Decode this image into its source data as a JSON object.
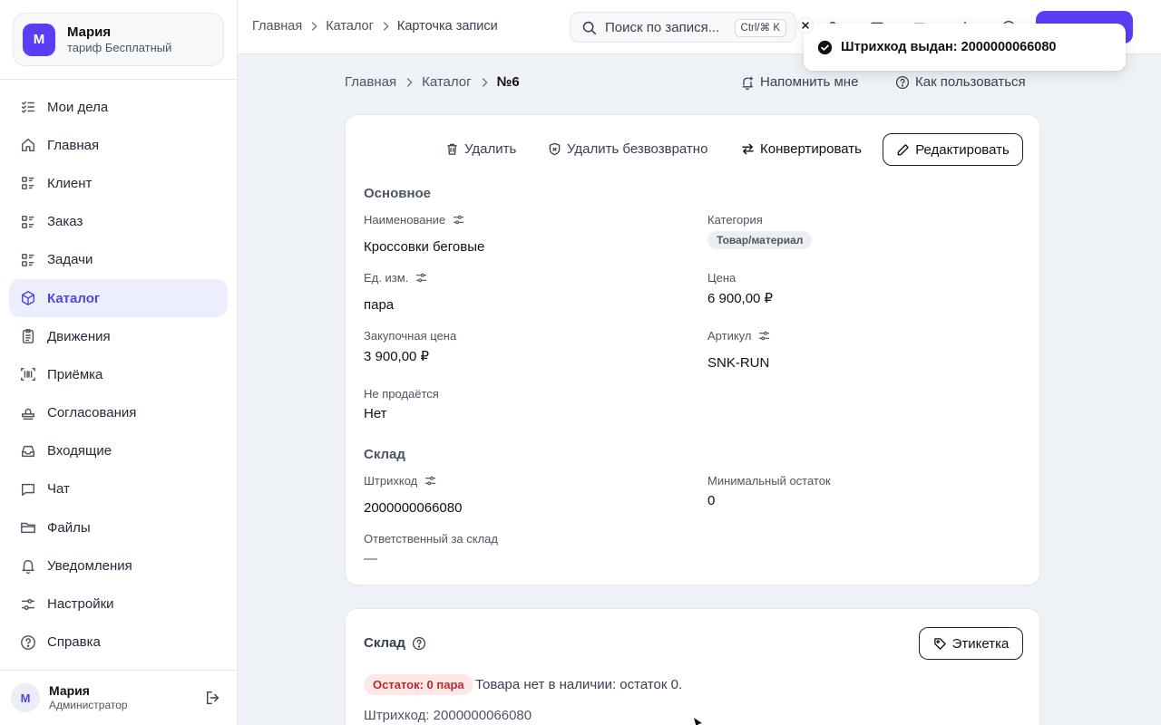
{
  "org": {
    "initial": "М",
    "name": "Мария",
    "plan": "тариф Бесплатный"
  },
  "nav": {
    "items": [
      {
        "label": "Мои дела",
        "icon": "checklist-icon"
      },
      {
        "label": "Главная",
        "icon": "home-icon"
      },
      {
        "label": "Клиент",
        "icon": "list-icon"
      },
      {
        "label": "Заказ",
        "icon": "list-icon"
      },
      {
        "label": "Задачи",
        "icon": "list-icon"
      },
      {
        "label": "Каталог",
        "icon": "cube-icon",
        "active": true
      },
      {
        "label": "Движения",
        "icon": "clipboard-icon"
      },
      {
        "label": "Приёмка",
        "icon": "barcode-scan-icon"
      },
      {
        "label": "Согласования",
        "icon": "stamp-icon"
      },
      {
        "label": "Входящие",
        "icon": "inbox-icon"
      },
      {
        "label": "Чат",
        "icon": "chat-icon"
      },
      {
        "label": "Файлы",
        "icon": "folder-icon"
      },
      {
        "label": "Уведомления",
        "icon": "bell-icon"
      },
      {
        "label": "Настройки",
        "icon": "sliders-icon"
      },
      {
        "label": "Справка",
        "icon": "help-circle-icon"
      }
    ]
  },
  "user": {
    "initial": "М",
    "name": "Мария",
    "role": "Администратор"
  },
  "topbar": {
    "crumbs": [
      "Главная",
      "Каталог",
      "Карточка записи"
    ],
    "search_placeholder": "Поиск по записям",
    "search_display": "Поиск по запися...",
    "shortcut": "Ctrl/⌘ K"
  },
  "toast": {
    "text": "Штрихкод выдан: 2000000066080"
  },
  "page": {
    "crumbs": [
      "Главная",
      "Каталог",
      "№6"
    ],
    "remind": "Напомнить мне",
    "howto": "Как пользоваться"
  },
  "actions": {
    "delete": "Удалить",
    "delete_forever": "Удалить безвозвратно",
    "convert": "Конвертировать",
    "edit": "Редактировать"
  },
  "main_section": {
    "title": "Основное",
    "name_label": "Наименование",
    "name_value": "Кроссовки беговые",
    "category_label": "Категория",
    "category_value": "Товар/материал",
    "unit_label": "Ед. изм.",
    "unit_value": "пара",
    "price_label": "Цена",
    "price_value": "6 900,00 ₽",
    "purchase_label": "Закупочная цена",
    "purchase_value": "3 900,00 ₽",
    "sku_label": "Артикул",
    "sku_value": "SNK-RUN",
    "notsold_label": "Не продаётся",
    "notsold_value": "Нет"
  },
  "warehouse_section": {
    "title": "Склад",
    "barcode_label": "Штрихкод",
    "barcode_value": "2000000066080",
    "min_label": "Минимальный остаток",
    "min_value": "0",
    "resp_label": "Ответственный за склад",
    "resp_value": "—"
  },
  "stock_card": {
    "title": "Склад",
    "label_button": "Этикетка",
    "badge": "Остаток: 0 пара",
    "message": "Товара нет в наличии: остаток 0.",
    "barcode_line": "Штрихкод: 2000000066080"
  },
  "colors": {
    "accent": "#5b3df5",
    "active_bg": "#eceefe",
    "danger": "#c0262d"
  }
}
